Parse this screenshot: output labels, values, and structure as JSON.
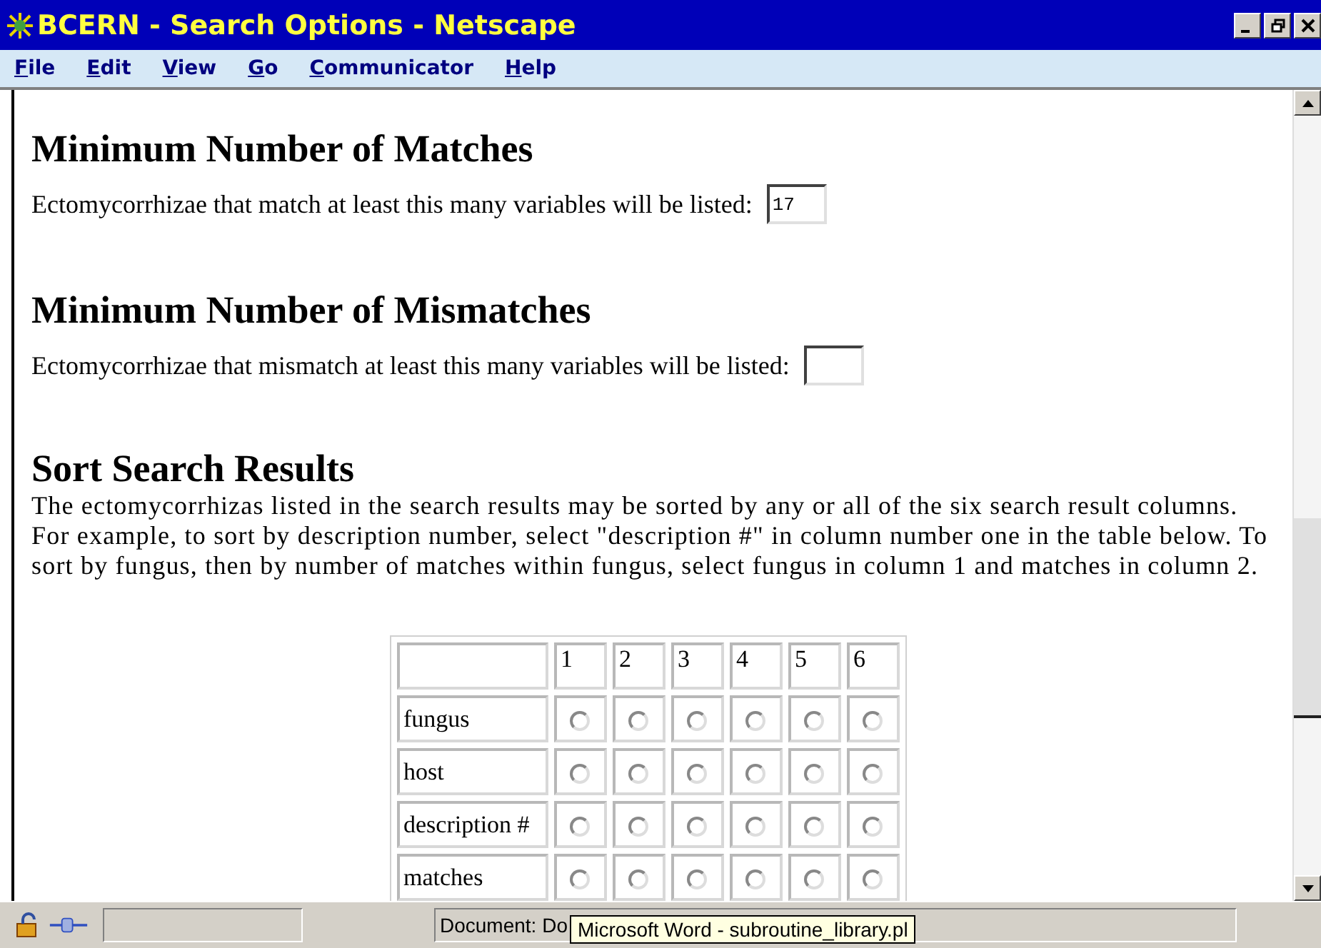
{
  "window": {
    "title": "BCERN - Search Options - Netscape"
  },
  "menu": [
    {
      "label": "File"
    },
    {
      "label": "Edit"
    },
    {
      "label": "View"
    },
    {
      "label": "Go"
    },
    {
      "label": "Communicator"
    },
    {
      "label": "Help"
    }
  ],
  "sections": [
    {
      "heading": "Minimum Number of Matches",
      "kind": "field",
      "label": "Ectomycorrhizae that match at least this many variables will be listed:",
      "value": "17"
    },
    {
      "heading": "Minimum Number of Mismatches",
      "kind": "field",
      "label": "Ectomycorrhizae that mismatch at least this many variables will be listed:"
    },
    {
      "heading": "Sort Search Results",
      "kind": "table",
      "text": "The ectomycorrhizas listed in the search results may be sorted by any or all of the six search result columns.  For example, to sort by description number, select \"description #\" in column number one in the table below.  To sort by fungus, then by number of matches within fungus, select fungus in column 1 and matches in column 2.",
      "table": {
        "columns": [
          "1",
          "2",
          "3",
          "4",
          "5",
          "6"
        ],
        "rows": [
          {
            "label": "fungus",
            "options": [
              {
                "selected": false
              },
              {
                "selected": false
              },
              {
                "selected": false
              },
              {
                "selected": false
              },
              {
                "selected": false
              },
              {
                "selected": false
              }
            ]
          },
          {
            "label": "host",
            "options": [
              {
                "selected": false
              },
              {
                "selected": false
              },
              {
                "selected": false
              },
              {
                "selected": false
              },
              {
                "selected": false
              },
              {
                "selected": false
              }
            ]
          },
          {
            "label": "description #",
            "options": [
              {
                "selected": false
              },
              {
                "selected": false
              },
              {
                "selected": false
              },
              {
                "selected": false
              },
              {
                "selected": false
              },
              {
                "selected": false
              }
            ]
          },
          {
            "label": "matches",
            "options": [
              {
                "selected": false
              },
              {
                "selected": false
              },
              {
                "selected": false
              },
              {
                "selected": false
              },
              {
                "selected": false
              },
              {
                "selected": false
              }
            ]
          }
        ]
      }
    }
  ],
  "status_bar": {
    "text": "Document: Do",
    "tooltip": "Microsoft Word - subroutine_library.pl"
  }
}
